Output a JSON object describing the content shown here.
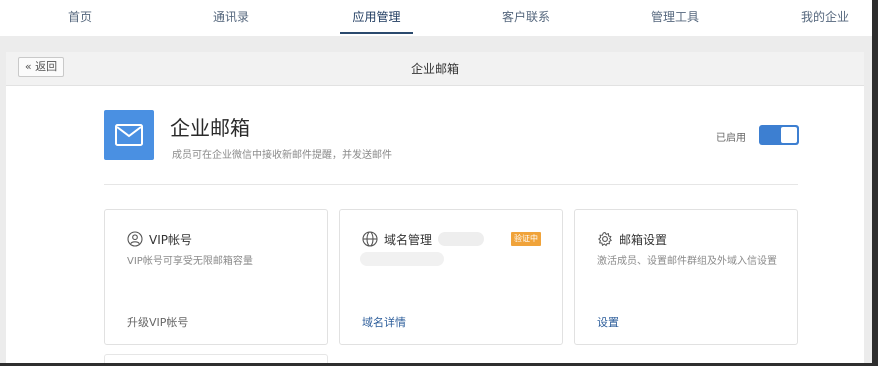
{
  "nav": {
    "items": [
      {
        "label": "首页"
      },
      {
        "label": "通讯录"
      },
      {
        "label": "应用管理"
      },
      {
        "label": "客户联系"
      },
      {
        "label": "管理工具"
      },
      {
        "label": "我的企业"
      }
    ],
    "active": "应用管理"
  },
  "header": {
    "back_label": "« 返回",
    "title": "企业邮箱"
  },
  "app": {
    "icon": "mail-icon",
    "name": "企业邮箱",
    "description": "成员可在企业微信中接收新邮件提醒，并发送邮件",
    "status_label": "已启用",
    "enabled": true
  },
  "cards": {
    "vip": {
      "icon": "user-circle-icon",
      "title": "VIP帐号",
      "description": "VIP帐号可享受无限邮箱容量",
      "link": "升级VIP帐号"
    },
    "domain": {
      "icon": "globe-icon",
      "title": "域名管理",
      "badge": "验证中",
      "link": "域名详情"
    },
    "settings": {
      "icon": "gear-icon",
      "title": "邮箱设置",
      "description": "激活成员、设置邮件群组及外域入信设置",
      "link": "设置"
    }
  },
  "colors": {
    "accent": "#4a90e2",
    "toggle": "#3d7fd1",
    "badge": "#f0a33a",
    "link": "#2b5c9a"
  }
}
